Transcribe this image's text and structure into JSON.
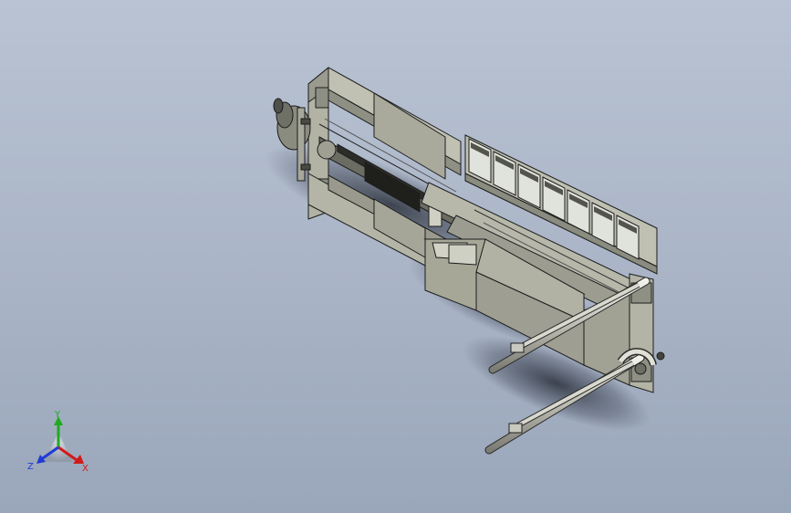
{
  "viewport": {
    "background_top": "#b9c3d3",
    "background_bottom": "#9aa6ba"
  },
  "model": {
    "body_color": "#a8a99b",
    "body_dark": "#85867a",
    "body_light": "#c6c6b8",
    "panel_glass": "#e3e6df"
  },
  "triad": {
    "x_label": "X",
    "y_label": "Y",
    "z_label": "Z",
    "x_color": "#d21a1a",
    "y_color": "#1faa1f",
    "z_color": "#1f3bd4"
  }
}
